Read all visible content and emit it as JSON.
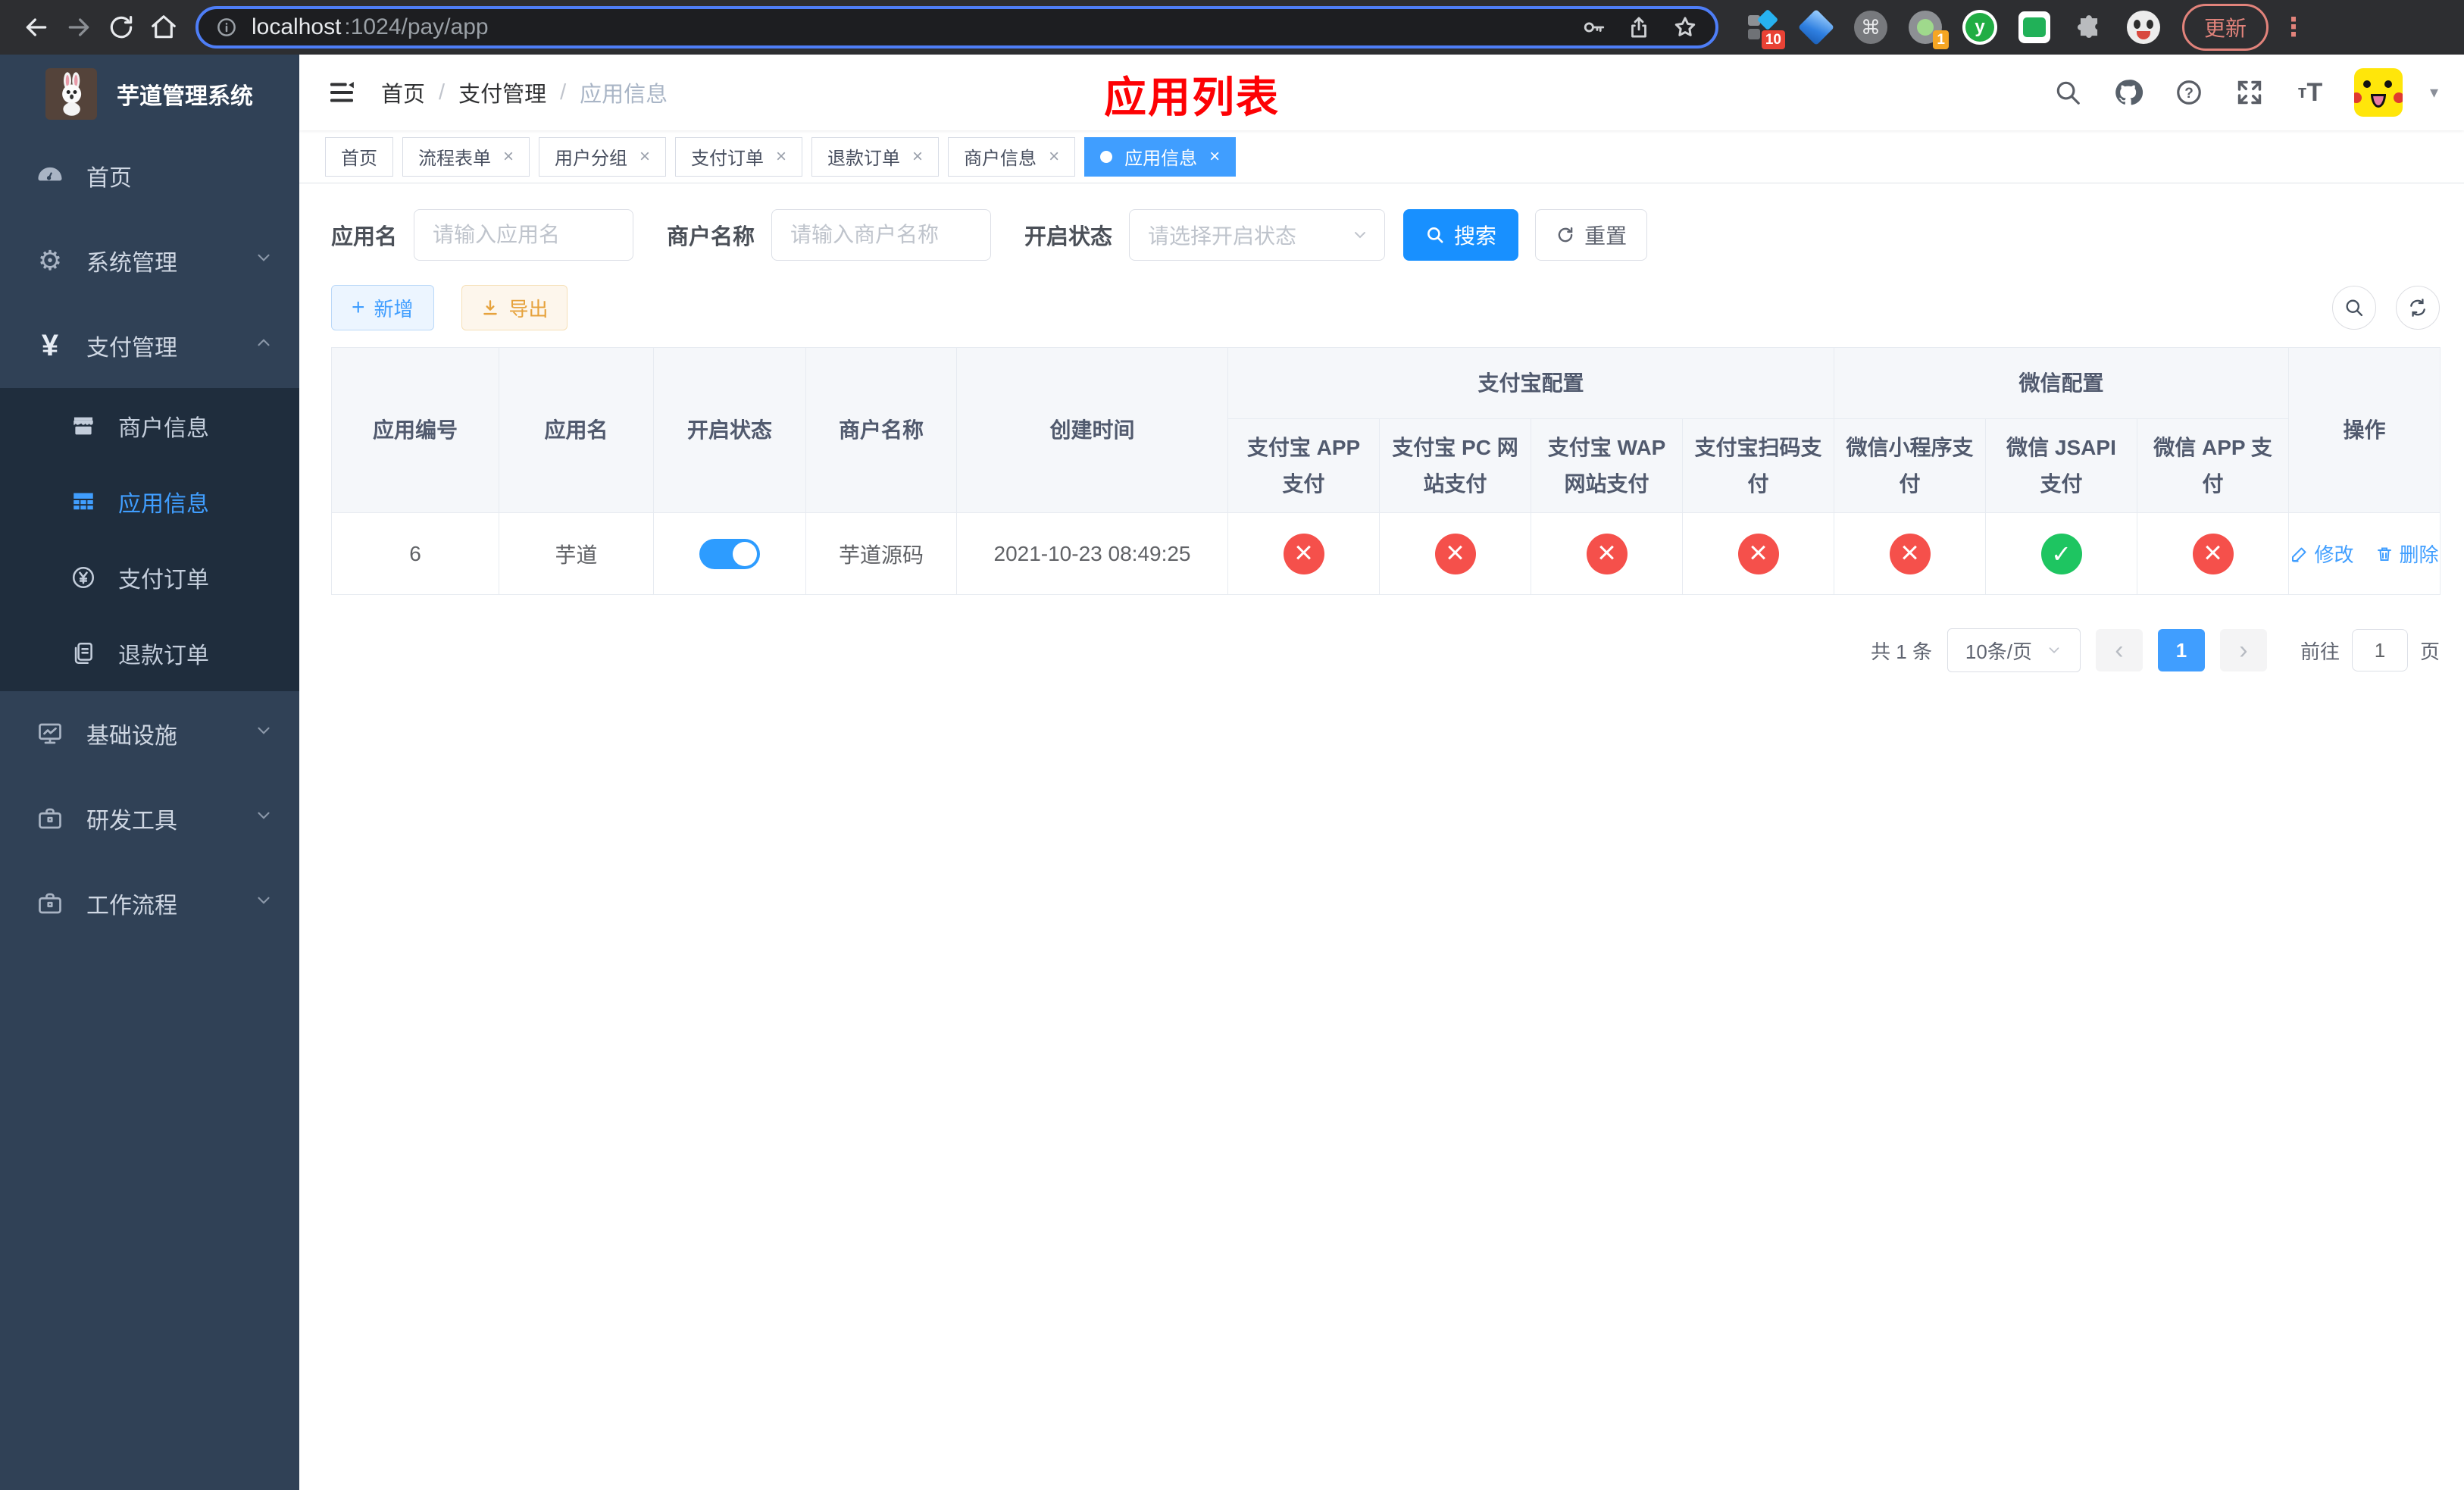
{
  "browser": {
    "url_host": "localhost",
    "url_rest": ":1024/pay/app",
    "update_label": "更新",
    "badge_ten": "10",
    "badge_one": "1"
  },
  "icons": {
    "gear": "⚙",
    "yen": "¥",
    "cmd": "⌘",
    "caret": "▾",
    "close": "×",
    "dots": "⋮",
    "prev": "‹",
    "next": "›",
    "slash": "/",
    "plus": "+",
    "question": "?",
    "y_letter": "y",
    "text_size_small": "т",
    "text_size_big": "T"
  },
  "sidebar": {
    "title": "芋道管理系统",
    "menu": [
      {
        "label": "首页"
      },
      {
        "label": "系统管理"
      },
      {
        "label": "支付管理"
      },
      {
        "label": "基础设施"
      },
      {
        "label": "研发工具"
      },
      {
        "label": "工作流程"
      }
    ],
    "submenu": [
      {
        "label": "商户信息"
      },
      {
        "label": "应用信息"
      },
      {
        "label": "支付订单"
      },
      {
        "label": "退款订单"
      }
    ]
  },
  "navbar": {
    "breadcrumb": [
      "首页",
      "支付管理",
      "应用信息"
    ]
  },
  "annotation": "应用列表",
  "tabs": [
    {
      "label": "首页"
    },
    {
      "label": "流程表单"
    },
    {
      "label": "用户分组"
    },
    {
      "label": "支付订单"
    },
    {
      "label": "退款订单"
    },
    {
      "label": "商户信息"
    },
    {
      "label": "应用信息"
    }
  ],
  "filter": {
    "app_name_label": "应用名",
    "app_name_placeholder": "请输入应用名",
    "merchant_label": "商户名称",
    "merchant_placeholder": "请输入商户名称",
    "status_label": "开启状态",
    "status_placeholder": "请选择开启状态",
    "search_label": "搜索",
    "reset_label": "重置"
  },
  "toolbar": {
    "add_label": "新增",
    "export_label": "导出"
  },
  "table": {
    "columns": [
      "应用编号",
      "应用名",
      "开启状态",
      "商户名称",
      "创建时间"
    ],
    "group_alipay": "支付宝配置",
    "group_wechat": "微信配置",
    "pay_columns": [
      "支付宝 APP 支付",
      "支付宝 PC 网站支付",
      "支付宝 WAP 网站支付",
      "支付宝扫码支付",
      "微信小程序支付",
      "微信 JSAPI 支付",
      "微信 APP 支付"
    ],
    "actions_column": "操作",
    "row": {
      "id": "6",
      "name": "芋道",
      "enabled": true,
      "merchant": "芋道源码",
      "created": "2021-10-23 08:49:25",
      "statuses": [
        "no",
        "no",
        "no",
        "no",
        "no",
        "yes",
        "no"
      ],
      "edit_label": "修改",
      "delete_label": "删除"
    }
  },
  "pagination": {
    "total": "共 1 条",
    "page_size": "10条/页",
    "current_page": "1",
    "goto_label": "前往",
    "goto_value": "1",
    "page_label": "页"
  },
  "colors": {
    "accent": "#409eff",
    "danger": "#f5504b",
    "success": "#1ec561",
    "sidebar_bg": "#304156",
    "submenu_bg": "#1f2d3d"
  }
}
